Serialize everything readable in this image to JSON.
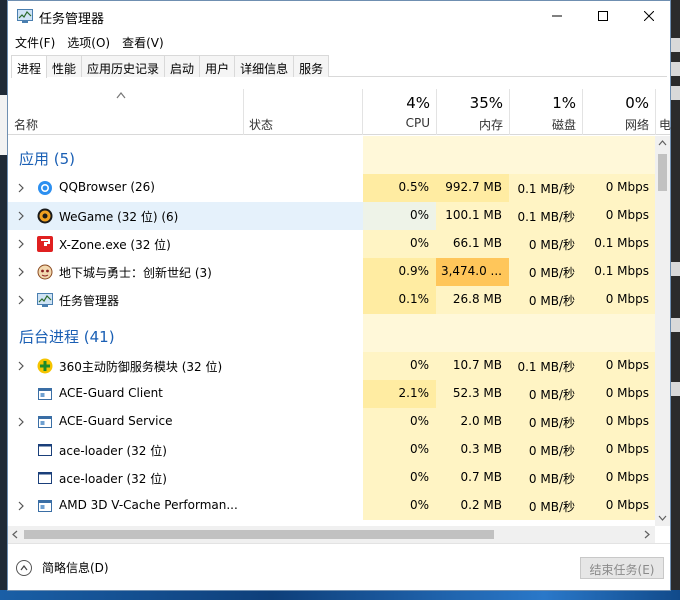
{
  "window": {
    "title": "任务管理器"
  },
  "menu": [
    "文件(F)",
    "选项(O)",
    "查看(V)"
  ],
  "tabs": [
    "进程",
    "性能",
    "应用历史记录",
    "启动",
    "用户",
    "详细信息",
    "服务"
  ],
  "header": {
    "name": "名称",
    "status": "状态",
    "cpu_pct": "4%",
    "cpu_label": "CPU",
    "mem_pct": "35%",
    "mem_label": "内存",
    "disk_pct": "1%",
    "disk_label": "磁盘",
    "net_pct": "0%",
    "net_label": "网络",
    "extra_label": "电"
  },
  "groups": {
    "apps": "应用 (5)",
    "background": "后台进程 (41)"
  },
  "apps": [
    {
      "name": "QQBrowser (26)",
      "cpu": "0.5%",
      "mem": "992.7 MB",
      "disk": "0.1 MB/秒",
      "net": "0 Mbps",
      "icon": "qqbrowser-icon"
    },
    {
      "name": "WeGame (32 位) (6)",
      "cpu": "0%",
      "mem": "100.1 MB",
      "disk": "0.1 MB/秒",
      "net": "0 Mbps",
      "icon": "wegame-icon"
    },
    {
      "name": "X-Zone.exe (32 位)",
      "cpu": "0%",
      "mem": "66.1 MB",
      "disk": "0 MB/秒",
      "net": "0.1 Mbps",
      "icon": "xzone-icon"
    },
    {
      "name": "地下城与勇士：创新世纪 (3)",
      "cpu": "0.9%",
      "mem": "3,474.0 ...",
      "disk": "0 MB/秒",
      "net": "0.1 Mbps",
      "icon": "dnf-icon"
    },
    {
      "name": "任务管理器",
      "cpu": "0.1%",
      "mem": "26.8 MB",
      "disk": "0 MB/秒",
      "net": "0 Mbps",
      "icon": "task-manager-icon"
    }
  ],
  "background": [
    {
      "name": "360主动防御服务模块 (32 位)",
      "cpu": "0%",
      "mem": "10.7 MB",
      "disk": "0.1 MB/秒",
      "net": "0 Mbps",
      "icon": "360-icon"
    },
    {
      "name": "ACE-Guard Client",
      "cpu": "2.1%",
      "mem": "52.3 MB",
      "disk": "0 MB/秒",
      "net": "0 Mbps",
      "icon": "app-window-icon"
    },
    {
      "name": "ACE-Guard Service",
      "cpu": "0%",
      "mem": "2.0 MB",
      "disk": "0 MB/秒",
      "net": "0 Mbps",
      "icon": "app-window-icon"
    },
    {
      "name": "ace-loader (32 位)",
      "cpu": "0%",
      "mem": "0.3 MB",
      "disk": "0 MB/秒",
      "net": "0 Mbps",
      "icon": "app-window-icon"
    },
    {
      "name": "ace-loader (32 位)",
      "cpu": "0%",
      "mem": "0.7 MB",
      "disk": "0 MB/秒",
      "net": "0 Mbps",
      "icon": "app-window-icon"
    },
    {
      "name": "AMD 3D V-Cache Performan...",
      "cpu": "0%",
      "mem": "0.2 MB",
      "disk": "0 MB/秒",
      "net": "0 Mbps",
      "icon": "app-window-icon"
    }
  ],
  "footer": {
    "fewer_details": "简略信息(D)",
    "end_task": "结束任务(E)"
  }
}
